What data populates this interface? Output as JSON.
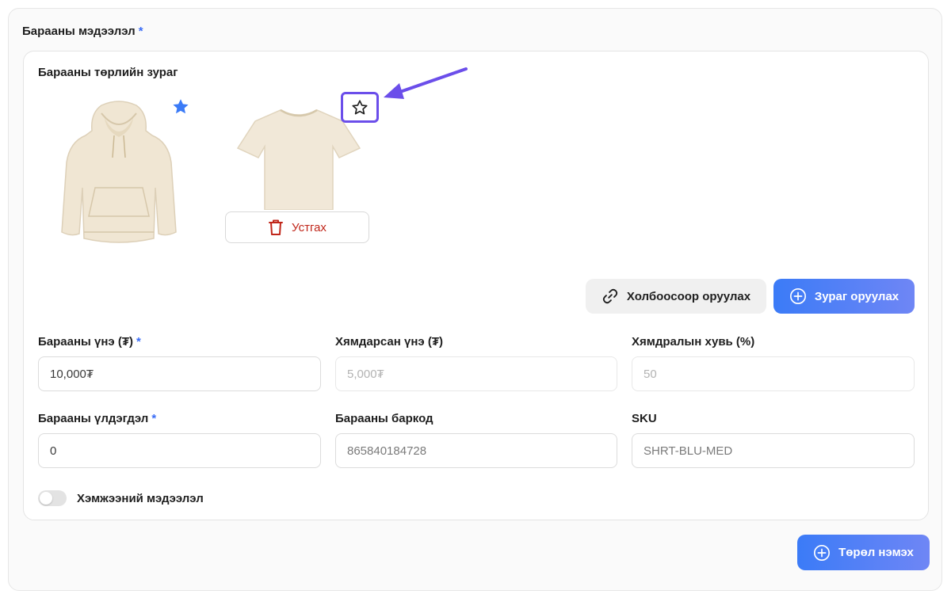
{
  "section": {
    "title": "Барааны мэдээлэл",
    "required_mark": "*"
  },
  "images": {
    "title": "Барааны төрлийн зураг",
    "delete_label": "Устгах",
    "link_button_label": "Холбоосоор оруулах",
    "upload_button_label": "Зураг оруулах",
    "primary_star_color": "#3b7bf7",
    "highlight_color": "#6b4eea"
  },
  "fields": {
    "price": {
      "label": "Барааны үнэ (₮)",
      "required_mark": "*",
      "value": "10,000₮"
    },
    "discount_price": {
      "label": "Хямдарсан үнэ (₮)",
      "placeholder": "5,000₮"
    },
    "discount_percent": {
      "label": "Хямдралын хувь (%)",
      "placeholder": "50"
    },
    "stock": {
      "label": "Барааны үлдэгдэл",
      "required_mark": "*",
      "value": "0"
    },
    "barcode": {
      "label": "Барааны баркод",
      "value": "865840184728"
    },
    "sku": {
      "label": "SKU",
      "value": "SHRT-BLU-MED"
    }
  },
  "size_toggle": {
    "label": "Хэмжээний мэдээлэл",
    "enabled": false
  },
  "add_variant_label": "Төрөл нэмэх"
}
